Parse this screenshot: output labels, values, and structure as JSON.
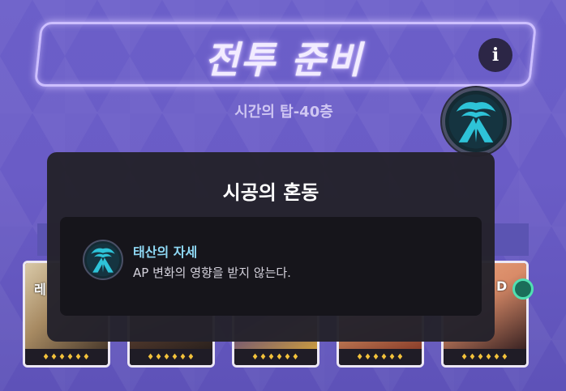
{
  "header": {
    "title": "전투 준비",
    "info_glyph": "i",
    "stage_label": "시간의 탑-40층"
  },
  "modal": {
    "title": "시공의 혼동",
    "skill": {
      "name": "태산의 자세",
      "description": "AP 변화의 영향을 받지 않는다.",
      "icon": "mountain-storm-emblem"
    }
  },
  "roster": {
    "cards": [
      {
        "label": "레",
        "stars": "♦♦♦♦♦♦",
        "art_colors": [
          "#d9c9a8",
          "#7a5a3a"
        ]
      },
      {
        "label": "",
        "stars": "♦♦♦♦♦♦",
        "art_colors": [
          "#b07a52",
          "#3a2c25"
        ]
      },
      {
        "label": "",
        "stars": "♦♦♦♦♦♦",
        "art_colors": [
          "#8f7fb8",
          "#c89a3f"
        ]
      },
      {
        "label": "",
        "stars": "♦♦♦♦♦♦",
        "art_colors": [
          "#e0a070",
          "#8a3e2a"
        ]
      },
      {
        "label": "D",
        "stars": "♦♦♦♦♦♦",
        "art_colors": [
          "#d98b68",
          "#3a2323"
        ]
      }
    ]
  },
  "colors": {
    "background": "#6a5cc6",
    "frame_glow": "#cdbfff",
    "skill_name": "#8fd9f5",
    "star": "#f3c23b",
    "emblem": "#2ec3d8"
  }
}
